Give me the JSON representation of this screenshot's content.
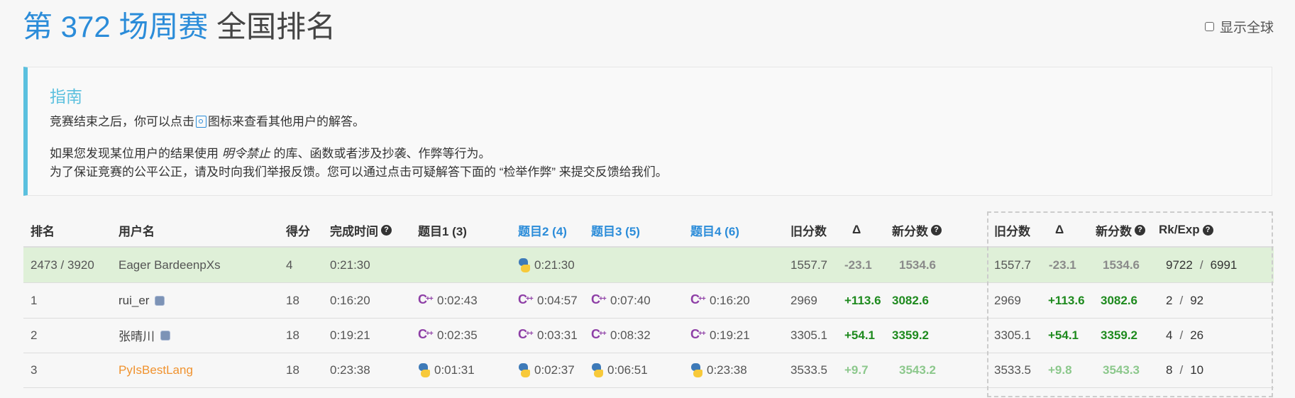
{
  "page": {
    "title_accent": "第 372 场周赛",
    "title_rest": "全国排名",
    "show_global_label": "显示全球"
  },
  "guide": {
    "title": "指南",
    "line1_pre": "竞赛结束之后，你可以点击",
    "line1_post": "图标来查看其他用户的解答。",
    "line2_pre": "如果您发现某位用户的结果使用",
    "line2_italic": "明令禁止",
    "line2_post": "的库、函数或者涉及抄袭、作弊等行为。",
    "line3": "为了保证竞赛的公平公正，请及时向我们举报反馈。您可以通过点击可疑解答下面的 “检举作弊” 来提交反馈给我们。"
  },
  "table": {
    "headers": {
      "rank": "排名",
      "user": "用户名",
      "score": "得分",
      "finish_time": "完成时间",
      "q1": "题目1 (3)",
      "q2": "题目2 (4)",
      "q3": "题目3 (5)",
      "q4": "题目4 (6)",
      "old_rating": "旧分数",
      "delta": "Δ",
      "new_rating": "新分数",
      "old_rating2": "旧分数",
      "delta2": "Δ",
      "new_rating2": "新分数",
      "rk_exp": "Rk/Exp"
    },
    "rows": [
      {
        "rank": "2473 / 3920",
        "user": "Eager BardeenpXs",
        "score": "4",
        "finish": "0:21:30",
        "q1": "",
        "q1_lang": "",
        "q2": "0:21:30",
        "q2_lang": "python",
        "q3": "",
        "q3_lang": "",
        "q4": "",
        "q4_lang": "",
        "old": "1557.7",
        "delta": "-23.1",
        "new": "1534.6",
        "old2": "1557.7",
        "delta2": "-23.1",
        "new2": "1534.6",
        "rk": "9722",
        "sep": "/",
        "exp": "6991"
      },
      {
        "rank": "1",
        "user": "rui_er",
        "score": "18",
        "finish": "0:16:20",
        "q1": "0:02:43",
        "q1_lang": "cpp",
        "q2": "0:04:57",
        "q2_lang": "cpp",
        "q3": "0:07:40",
        "q3_lang": "cpp",
        "q4": "0:16:20",
        "q4_lang": "cpp",
        "old": "2969",
        "delta": "+113.6",
        "new": "3082.6",
        "old2": "2969",
        "delta2": "+113.6",
        "new2": "3082.6",
        "rk": "2",
        "sep": "/",
        "exp": "92"
      },
      {
        "rank": "2",
        "user": "张晴川",
        "score": "18",
        "finish": "0:19:21",
        "q1": "0:02:35",
        "q1_lang": "cpp",
        "q2": "0:03:31",
        "q2_lang": "cpp",
        "q3": "0:08:32",
        "q3_lang": "cpp",
        "q4": "0:19:21",
        "q4_lang": "cpp",
        "old": "3305.1",
        "delta": "+54.1",
        "new": "3359.2",
        "old2": "3305.1",
        "delta2": "+54.1",
        "new2": "3359.2",
        "rk": "4",
        "sep": "/",
        "exp": "26"
      },
      {
        "rank": "3",
        "user": "PyIsBestLang",
        "score": "18",
        "finish": "0:23:38",
        "q1": "0:01:31",
        "q1_lang": "python",
        "q2": "0:02:37",
        "q2_lang": "python",
        "q3": "0:06:51",
        "q3_lang": "python",
        "q4": "0:23:38",
        "q4_lang": "python",
        "old": "3533.5",
        "delta": "+9.7",
        "new": "3543.2",
        "old2": "3533.5",
        "delta2": "+9.8",
        "new2": "3543.3",
        "rk": "8",
        "sep": "/",
        "exp": "10"
      }
    ]
  }
}
